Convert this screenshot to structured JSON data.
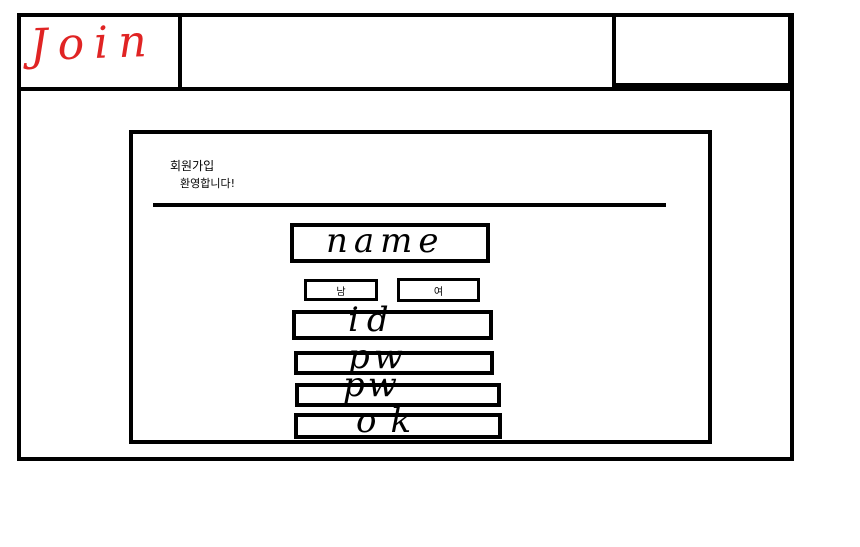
{
  "header": {
    "logo_text": "Join"
  },
  "join_form": {
    "title": "회원가입",
    "subtitle": "환영합니다!",
    "name_field": {
      "label": "name"
    },
    "gender": {
      "male_label": "남",
      "female_label": "여"
    },
    "id_field": {
      "label": "id"
    },
    "pw_field": {
      "label": "pw"
    },
    "pw_confirm_field": {
      "label": "pw"
    },
    "submit_label": "ok"
  }
}
